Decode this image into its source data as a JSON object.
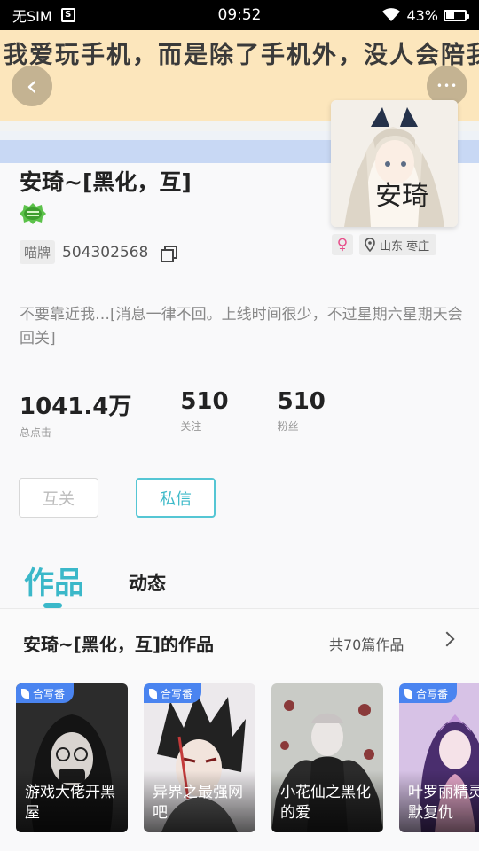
{
  "status_bar": {
    "carrier": "无SIM",
    "time": "09:52",
    "battery_percent": "43%",
    "battery_level": 0.43,
    "sim_glyph": "S"
  },
  "banner": {
    "text": "我爱玩手机，而是除了手机外，没人会陪我",
    "back_glyph": "‹",
    "more_glyph": "•••"
  },
  "profile": {
    "avatar_text": "安琦",
    "username": "安琦~[黑化，互]",
    "id_tag": "喵牌",
    "id_number": "504302568",
    "gender_glyph": "♀",
    "location": "山东 枣庄",
    "bio": "不要靠近我…[消息一律不回。上线时间很少，不过星期六星期天会回关]",
    "stats": [
      {
        "value": "1041.4万",
        "label": "总点击"
      },
      {
        "value": "510",
        "label": "关注"
      },
      {
        "value": "510",
        "label": "粉丝"
      }
    ],
    "follow_button": "互关",
    "message_button": "私信"
  },
  "tabs": {
    "works": "作品",
    "feed": "动态"
  },
  "works": {
    "title": "安琦~[黑化，互]的作品",
    "count": "共70篇作品",
    "items": [
      {
        "tag": "合写番",
        "title": "游戏大佬开黑屋"
      },
      {
        "tag": "合写番",
        "title": "异界之最强网吧"
      },
      {
        "tag": "合写番",
        "title": "小花仙之黑化的爱"
      },
      {
        "tag": "合写番",
        "title": "叶罗丽精灵王默复仇"
      }
    ]
  },
  "colors": {
    "accent": "#3bb8c9",
    "banner": "#fce6bc",
    "tag_blue": "#4a84f0",
    "gender_pink": "#e84d8a"
  }
}
